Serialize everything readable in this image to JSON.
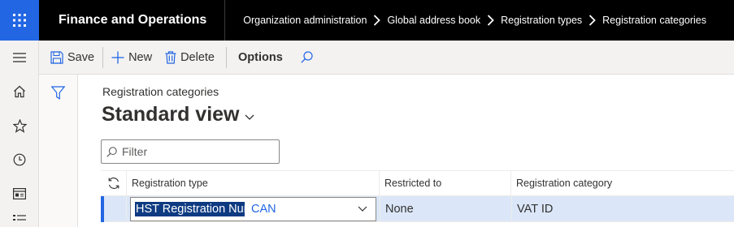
{
  "app": {
    "title": "Finance and Operations"
  },
  "breadcrumb": [
    "Organization administration",
    "Global address book",
    "Registration types",
    "Registration categories"
  ],
  "nav_icons": [
    "hamburger-icon",
    "home-icon",
    "star-icon",
    "clock-icon",
    "workspace-icon",
    "list-icon"
  ],
  "actions": {
    "save": "Save",
    "new": "New",
    "delete": "Delete",
    "options": "Options"
  },
  "page": {
    "caption": "Registration categories",
    "view_title": "Standard view",
    "filter_placeholder": "Filter"
  },
  "grid": {
    "columns": [
      "Registration type",
      "Restricted to",
      "Registration category"
    ],
    "rows": [
      {
        "registration_type": "HST Registration Num",
        "registration_type_suffix": "CAN",
        "restricted_to": "None",
        "registration_category": "VAT ID"
      }
    ]
  },
  "colors": {
    "accent": "#2266e3",
    "topbar": "#000000",
    "row_selected": "#dbe7f8",
    "text_selection": "#0e3a82"
  }
}
